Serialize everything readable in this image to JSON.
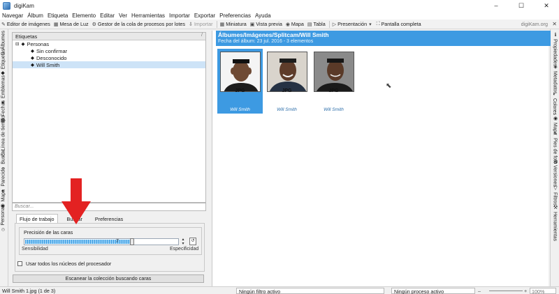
{
  "window": {
    "title": "digiKam",
    "controls": [
      "–",
      "☐",
      "✕"
    ]
  },
  "menubar": {
    "items": [
      "Navegar",
      "Álbum",
      "Etiqueta",
      "Elemento",
      "Editar",
      "Ver",
      "Herramientas",
      "Importar",
      "Exportar",
      "Preferencias",
      "Ayuda"
    ]
  },
  "toolbar": {
    "items": [
      {
        "label": "Editor de imágenes",
        "icon": "pencil-icon",
        "glyph": "✎"
      },
      {
        "label": "Mesa de Luz",
        "icon": "lighttable-icon",
        "glyph": "▦"
      },
      {
        "label": "Gestor de la cola de procesos por lotes",
        "icon": "queue-icon",
        "glyph": "⚙"
      },
      {
        "label": "Importar",
        "icon": "import-icon",
        "glyph": "⇩",
        "disabled": true
      },
      {
        "label": "Miniatura",
        "icon": "thumbnail-icon",
        "glyph": "▦"
      },
      {
        "label": "Vista previa",
        "icon": "preview-icon",
        "glyph": "▣"
      },
      {
        "label": "Mapa",
        "icon": "map-icon",
        "glyph": "◉"
      },
      {
        "label": "Tabla",
        "icon": "table-icon",
        "glyph": "▤"
      },
      {
        "label": "Presentación",
        "icon": "slideshow-icon",
        "glyph": "▷"
      },
      {
        "label": "Pantalla completa",
        "icon": "fullscreen-icon",
        "glyph": "⛶"
      }
    ],
    "brand": "digiKam.org"
  },
  "left_sidebar": {
    "tabs": [
      {
        "label": "Álbumes",
        "icon": "album-icon",
        "glyph": "▭"
      },
      {
        "label": "Etiquetas",
        "icon": "tag-icon",
        "glyph": "◆"
      },
      {
        "label": "Emblemas",
        "icon": "star-icon",
        "glyph": "★"
      },
      {
        "label": "Fechas",
        "icon": "calendar-icon",
        "glyph": "▦"
      },
      {
        "label": "Línea de tiempo",
        "icon": "clock-icon",
        "glyph": "◷"
      },
      {
        "label": "Buscar",
        "icon": "search-icon",
        "glyph": "⌕"
      },
      {
        "label": "Parecido",
        "icon": "wand-icon",
        "glyph": "✦"
      },
      {
        "label": "Mapa",
        "icon": "globe-icon",
        "glyph": "◉"
      },
      {
        "label": "Personas",
        "icon": "person-icon",
        "glyph": "☺"
      }
    ]
  },
  "right_sidebar": {
    "tabs": [
      {
        "label": "Propiedades",
        "icon": "properties-icon",
        "glyph": "ℹ"
      },
      {
        "label": "Metadatos",
        "icon": "metadata-icon",
        "glyph": "◈"
      },
      {
        "label": "Colores",
        "icon": "colors-icon",
        "glyph": "◐"
      },
      {
        "label": "Mapa",
        "icon": "map-icon",
        "glyph": "◉"
      },
      {
        "label": "Pies de foto",
        "icon": "caption-icon",
        "glyph": "✎"
      },
      {
        "label": "Versiones",
        "icon": "versions-icon",
        "glyph": "⧉"
      },
      {
        "label": "Filtros",
        "icon": "filter-icon",
        "glyph": "▽"
      },
      {
        "label": "Herramientas",
        "icon": "tools-icon",
        "glyph": "⚒"
      }
    ]
  },
  "tag_tree": {
    "header": "Etiquetas",
    "rows": [
      {
        "label": "Personas",
        "toggle": "⊟",
        "indent": 1
      },
      {
        "label": "Sin confirmar",
        "indent": 2
      },
      {
        "label": "Desconocido",
        "indent": 2
      },
      {
        "label": "Will Smith",
        "indent": 2,
        "selected": true
      }
    ],
    "search_placeholder": "Buscar..."
  },
  "face_panel": {
    "tabs": [
      "Flujo de trabajo",
      "Buscar",
      "Preferencias"
    ],
    "active_tab": 0,
    "group_title": "Precisión de las caras",
    "slider_value": "7",
    "slider_fraction": 0.7,
    "min_label": "Sensibilidad",
    "max_label": "Especificidad",
    "checkbox_label": "Usar todos los núcleos del procesador",
    "checkbox_checked": false,
    "scan_button": "Escanear la colección buscando caras"
  },
  "album": {
    "title": "Álbumes/Imágenes/Splitcam/Will Smith",
    "subtitle": "Fecha del álbum: 23 jul. 2016 - 3 elementos",
    "accent": "#3d9ae2",
    "thumbnails": [
      {
        "name": "Will Smith",
        "format": "JPG",
        "selected": true
      },
      {
        "name": "Will Smith",
        "format": "JPG",
        "selected": false
      },
      {
        "name": "Will Smith",
        "format": "JPG",
        "selected": false
      }
    ]
  },
  "statusbar": {
    "file": "Will Smith 1.jpg (1 de 3)",
    "filter": "Ningún filtro activo",
    "process": "Ningún proceso activo",
    "zoom": "100%"
  },
  "annotation": {
    "arrow_color": "#e32222"
  }
}
